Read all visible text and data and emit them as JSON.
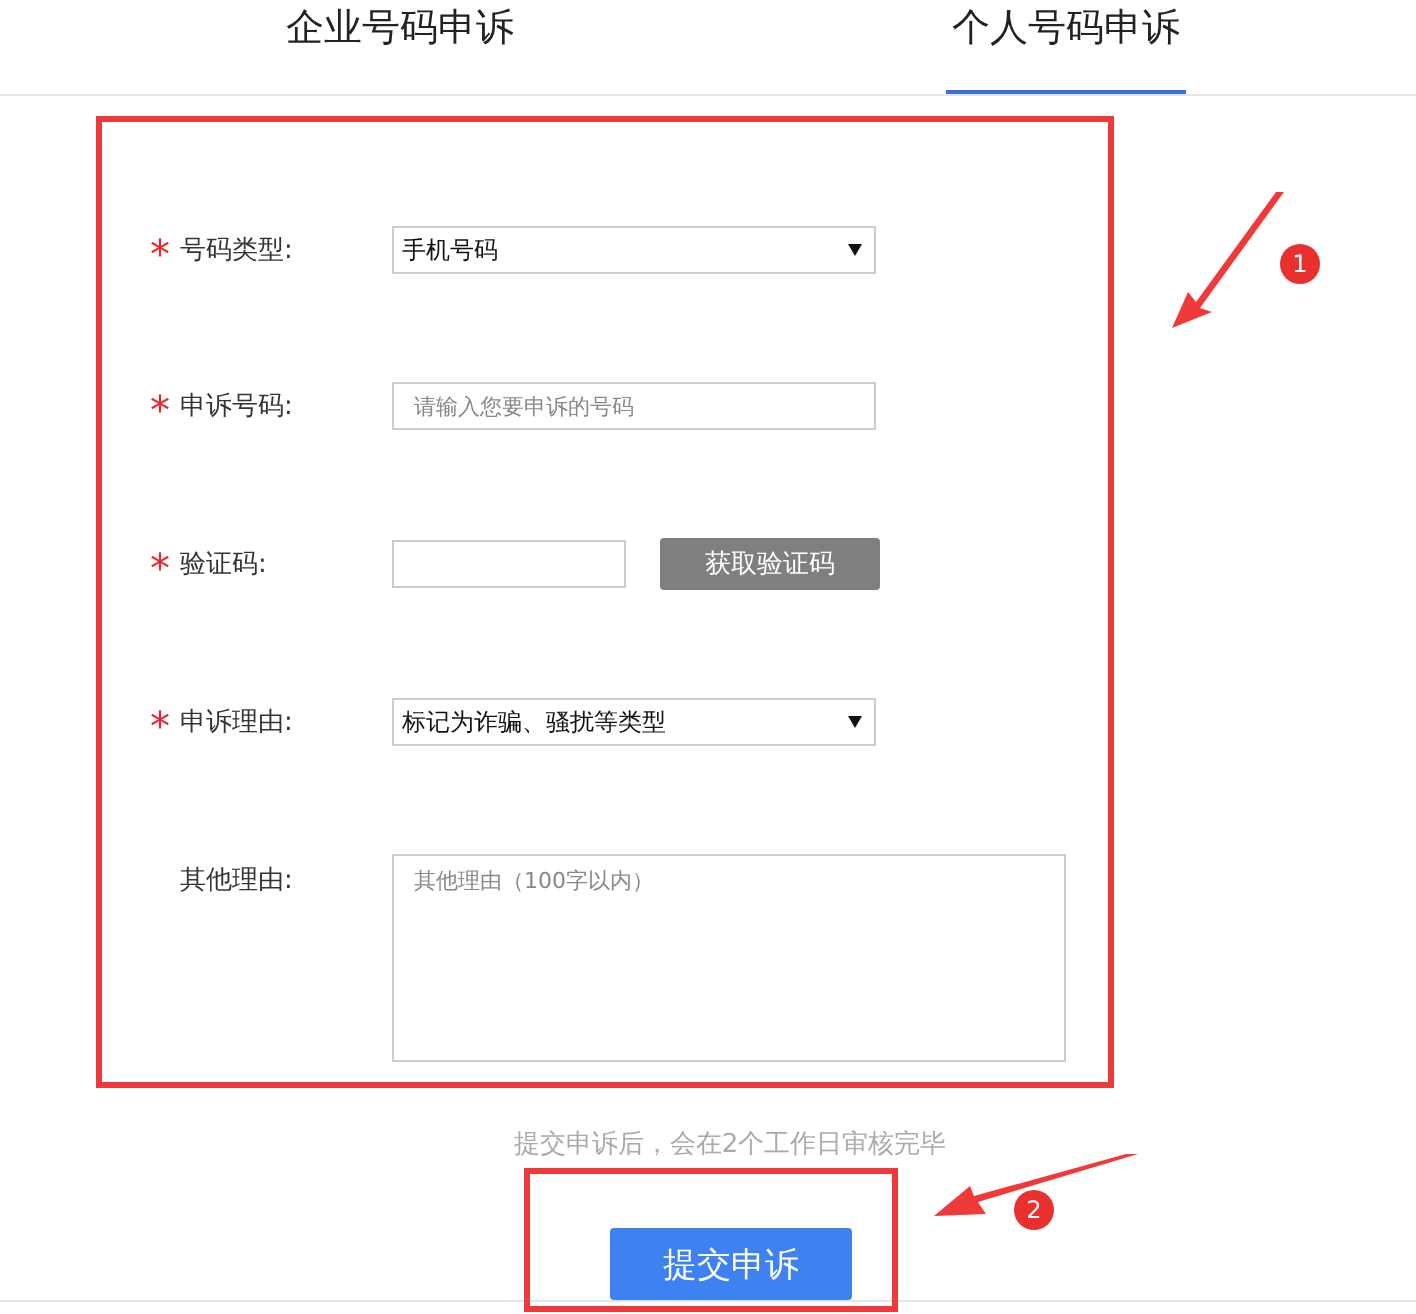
{
  "tabs": [
    {
      "label": "企业号码申诉",
      "selected": false
    },
    {
      "label": "个人号码申诉",
      "selected": true
    }
  ],
  "form": {
    "required_mark": "*",
    "fields": [
      {
        "kind": "select",
        "label": "号码类型:",
        "required": true,
        "value": "手机号码"
      },
      {
        "kind": "text",
        "label": "申诉号码:",
        "required": true,
        "placeholder": "请输入您要申诉的号码"
      },
      {
        "kind": "captcha",
        "label": "验证码:",
        "required": true,
        "button": "获取验证码"
      },
      {
        "kind": "select",
        "label": "申诉理由:",
        "required": true,
        "value": "标记为诈骗、骚扰等类型"
      },
      {
        "kind": "textarea",
        "label": "其他理由:",
        "required": false,
        "placeholder": "其他理由（100字以内）"
      }
    ]
  },
  "hint": "提交申诉后，会在2个工作日审核完毕",
  "submit_button": "提交申诉",
  "annotations": [
    {
      "number": "1"
    },
    {
      "number": "2"
    }
  ]
}
